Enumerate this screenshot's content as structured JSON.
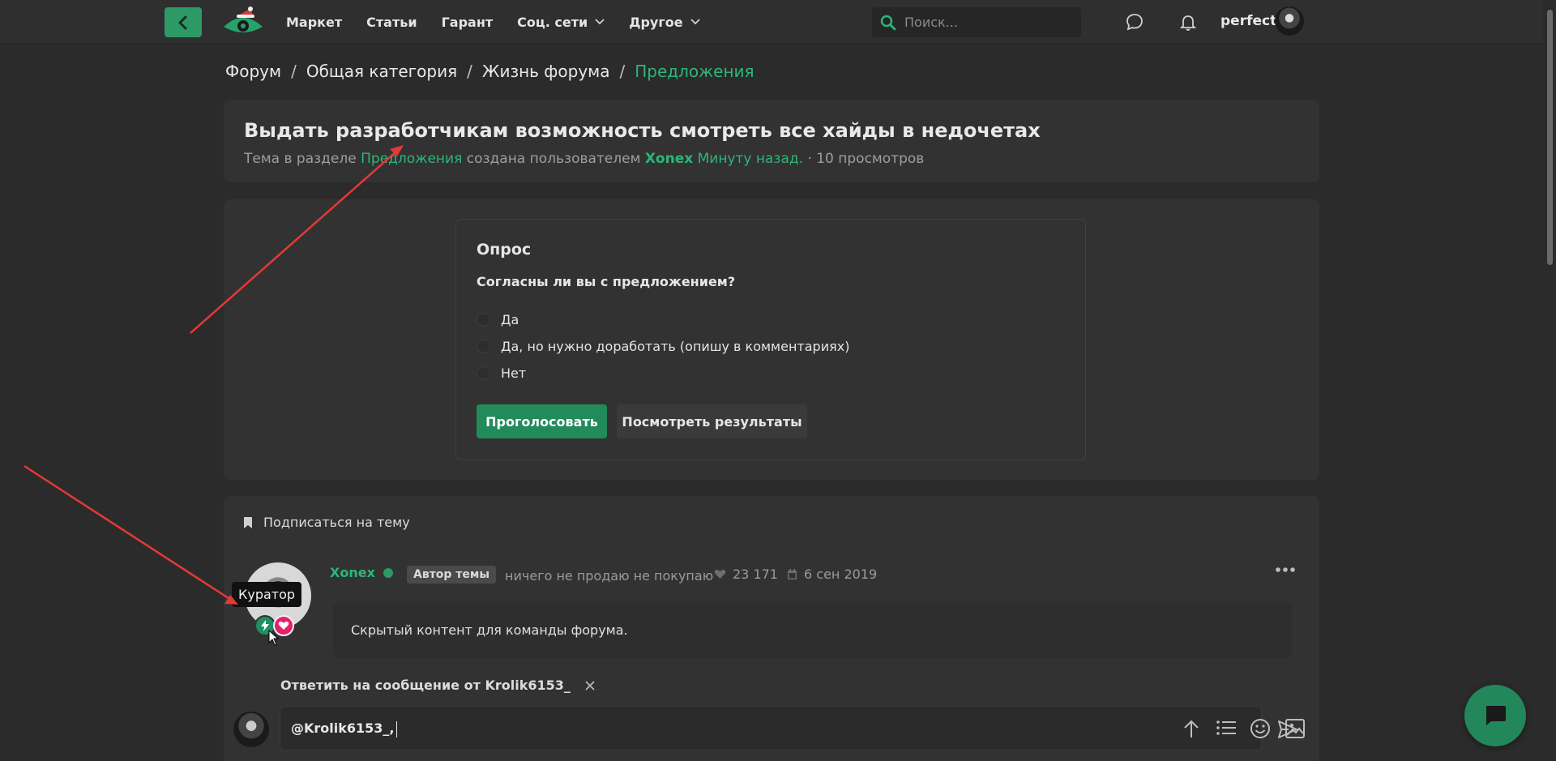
{
  "header": {
    "nav": [
      {
        "label": "Маркет"
      },
      {
        "label": "Статьи"
      },
      {
        "label": "Гарант"
      },
      {
        "label": "Соц. сети",
        "dropdown": true
      },
      {
        "label": "Другое",
        "dropdown": true
      }
    ],
    "search_placeholder": "Поиск...",
    "username": "perfect"
  },
  "breadcrumb": [
    "Форум",
    "Общая категория",
    "Жизнь форума",
    "Предложения"
  ],
  "topic": {
    "title": "Выдать разработчикам возможность смотреть все хайды в недочетах",
    "meta_prefix": "Тема в разделе",
    "section": "Предложения",
    "meta_mid": "создана пользователем",
    "author": "Xonex",
    "time": "Минуту назад.",
    "views": "· 10 просмотров"
  },
  "poll": {
    "heading": "Опрос",
    "question": "Согласны ли вы с предложением?",
    "options": [
      "Да",
      "Да, но нужно доработать (опишу в комментариях)",
      "Нет"
    ],
    "vote_label": "Проголосовать",
    "results_label": "Посмотреть результаты"
  },
  "post": {
    "subscribe_label": "Подписаться на тему",
    "author": "Xonex",
    "author_badge": "Автор темы",
    "status": "ничего не продаю не покупаю",
    "likes": "23 171",
    "registered": "6 сен 2019",
    "tooltip": "Куратор",
    "content": "Скрытый контент для команды форума."
  },
  "reply": {
    "label_prefix": "Ответить на сообщение от",
    "target": "Krolik6153_",
    "editor_text": "@Krolik6153_,"
  },
  "colors": {
    "accent": "#2cb678",
    "button_green": "#228b5a",
    "background": "#2b2b2b",
    "card": "#323232",
    "annotation_arrow": "#e53935"
  }
}
